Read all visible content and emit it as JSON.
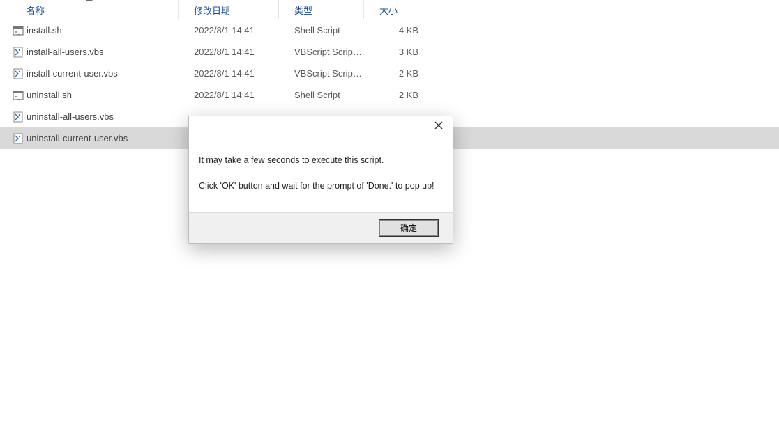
{
  "headers": {
    "name": "名称",
    "date": "修改日期",
    "type": "类型",
    "size": "大小"
  },
  "files": [
    {
      "name": "install.sh",
      "date": "2022/8/1 14:41",
      "type": "Shell Script",
      "size": "4 KB",
      "icon": "sh",
      "selected": false
    },
    {
      "name": "install-all-users.vbs",
      "date": "2022/8/1 14:41",
      "type": "VBScript Script ...",
      "size": "3 KB",
      "icon": "vbs",
      "selected": false
    },
    {
      "name": "install-current-user.vbs",
      "date": "2022/8/1 14:41",
      "type": "VBScript Script ...",
      "size": "2 KB",
      "icon": "vbs",
      "selected": false
    },
    {
      "name": "uninstall.sh",
      "date": "2022/8/1 14:41",
      "type": "Shell Script",
      "size": "2 KB",
      "icon": "sh",
      "selected": false
    },
    {
      "name": "uninstall-all-users.vbs",
      "date": "",
      "type": "",
      "size": "",
      "icon": "vbs",
      "selected": false
    },
    {
      "name": "uninstall-current-user.vbs",
      "date": "",
      "type": "",
      "size": "",
      "icon": "vbs",
      "selected": true
    }
  ],
  "dialog": {
    "line1": "It may take a few seconds to execute this script.",
    "line2": "Click 'OK' button and wait for the prompt of 'Done.' to pop up!",
    "ok": "确定"
  }
}
